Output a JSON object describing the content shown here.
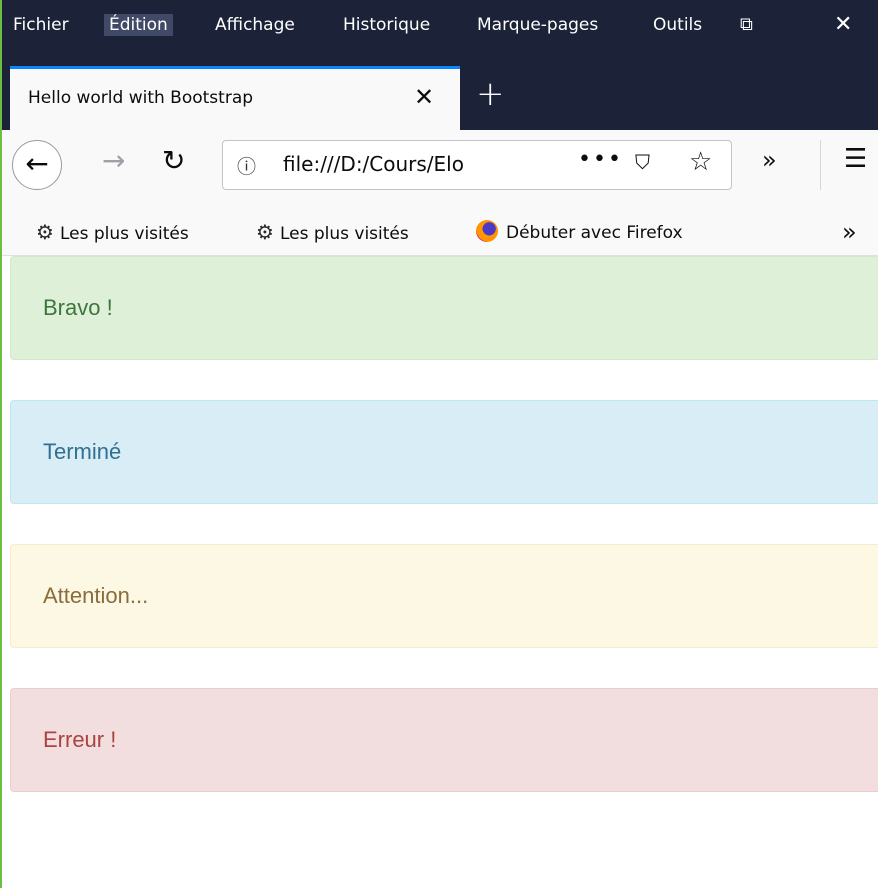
{
  "menu": {
    "items": [
      "Fichier",
      "Édition",
      "Affichage",
      "Historique",
      "Marque-pages",
      "Outils"
    ],
    "active": "Édition"
  },
  "tab": {
    "title": "Hello world with Bootstrap",
    "close_icon": "close-icon"
  },
  "navbar": {
    "url": "file:///D:/Cours/Elo",
    "icons": [
      "back-icon",
      "forward-icon",
      "reload-icon",
      "info-icon",
      "page-actions-icon",
      "pocket-icon",
      "bookmark-star-icon",
      "overflow-icon",
      "hamburger-menu-icon"
    ]
  },
  "bookmarks": {
    "items": [
      {
        "label": "Les plus visités",
        "icon": "gear-icon"
      },
      {
        "label": "Les plus visités",
        "icon": "gear-icon"
      },
      {
        "label": "Débuter avec Firefox",
        "icon": "firefox-icon"
      }
    ]
  },
  "alerts": [
    {
      "text": "Bravo !",
      "type": "success",
      "bg": "#dff0d8",
      "color": "#3c763d"
    },
    {
      "text": "Terminé",
      "type": "info",
      "bg": "#d9edf7",
      "color": "#31708f"
    },
    {
      "text": "Attention...",
      "type": "warning",
      "bg": "#fcf8e3",
      "color": "#8a6d3b"
    },
    {
      "text": "Erreur !",
      "type": "danger",
      "bg": "#f2dede",
      "color": "#a94442"
    }
  ],
  "colors": {
    "chrome_dark": "#1c2237",
    "tab_accent": "#0a84ff",
    "window_border": "#6abf40"
  }
}
